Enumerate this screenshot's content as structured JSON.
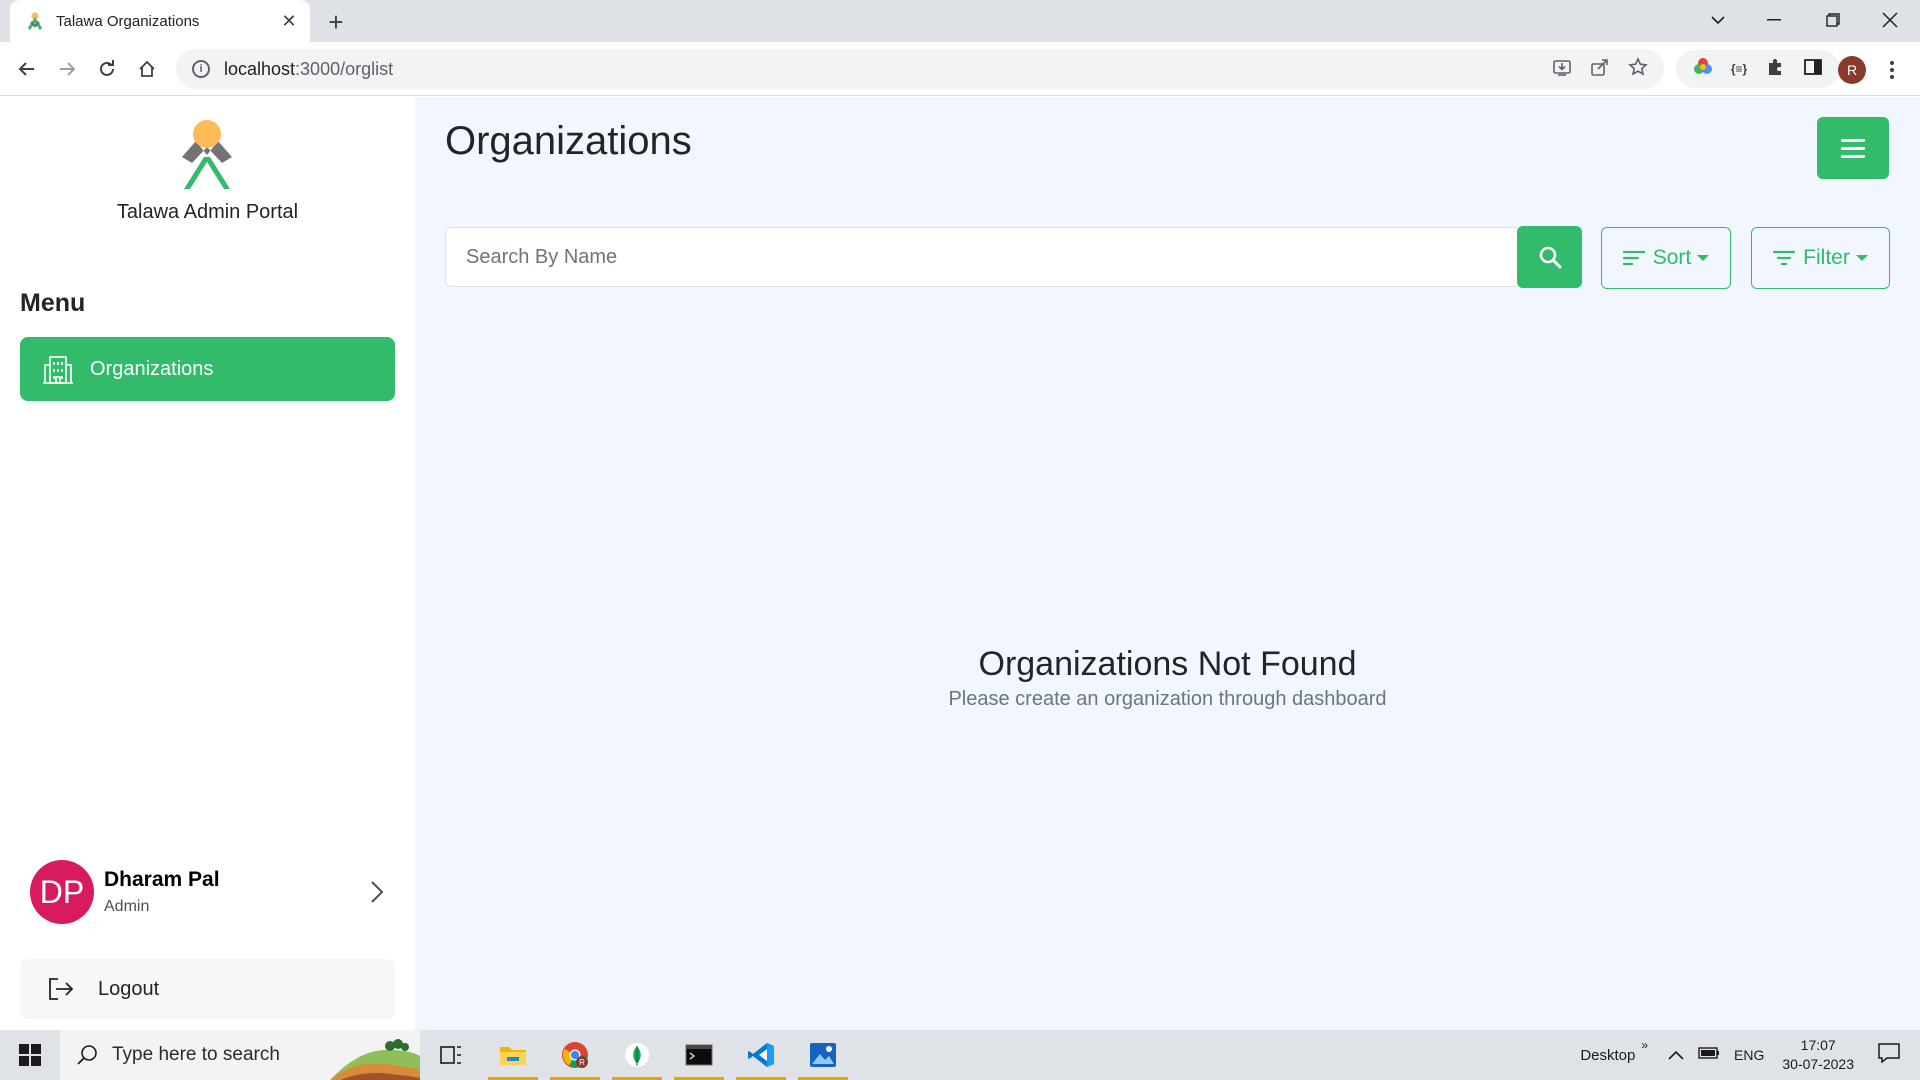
{
  "browser": {
    "tab_title": "Talawa Organizations",
    "url_host": "localhost",
    "url_rest": ":3000/orglist",
    "profile_initial": "R"
  },
  "sidebar": {
    "portal_name": "Talawa Admin Portal",
    "menu_title": "Menu",
    "nav_items": [
      {
        "label": "Organizations",
        "icon": "building-icon",
        "active": true
      }
    ],
    "user": {
      "initials": "DP",
      "name": "Dharam Pal",
      "role": "Admin"
    },
    "logout_label": "Logout"
  },
  "main": {
    "title": "Organizations",
    "search_placeholder": "Search By Name",
    "sort_label": "Sort",
    "filter_label": "Filter",
    "empty_title": "Organizations Not Found",
    "empty_subtitle": "Please create an organization through dashboard"
  },
  "taskbar": {
    "search_placeholder": "Type here to search",
    "desktop_label": "Desktop",
    "language": "ENG",
    "time": "17:07",
    "date": "30-07-2023"
  },
  "colors": {
    "accent": "#31bb6b",
    "main_bg": "#f2f7ff",
    "avatar_bg": "#d81b60"
  }
}
